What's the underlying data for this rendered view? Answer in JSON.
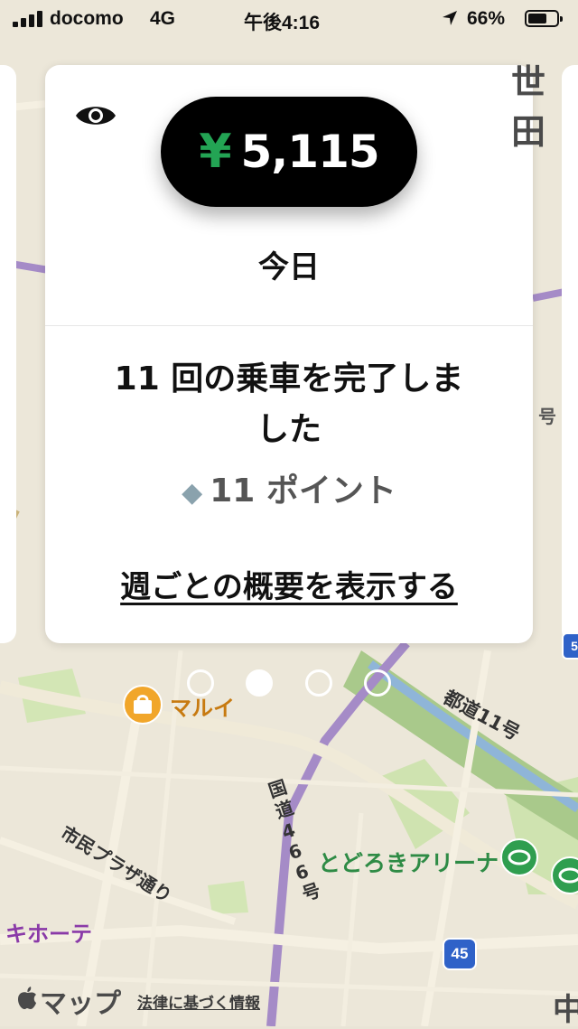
{
  "status_bar": {
    "carrier": "docomo",
    "network": "4G",
    "time": "午後4:16",
    "battery_percent_text": "66%",
    "battery_level": 0.66
  },
  "earnings_card": {
    "currency_symbol": "¥",
    "amount": "5,115",
    "period": "今日",
    "trips_line1": "11 回の乗車を完了しま",
    "trips_line2": "した",
    "points_icon": "◆",
    "points": "11 ポイント",
    "weekly_link": "週ごとの概要を表示する"
  },
  "pager": {
    "count": 4,
    "active_index": 1
  },
  "map": {
    "labels": {
      "marui": "マルイ",
      "route11": "都道11号",
      "route466": "国道466号",
      "plaza": "市民プラザ通り",
      "arena": "とどろきアリーナ",
      "donki": "キホーテ",
      "setagaya": "世田",
      "route_no": "号",
      "naka": "中",
      "shield45": "45",
      "shield5": "5"
    },
    "maps_logo": "マップ",
    "legal": "法律に基づく情報"
  },
  "icons": {
    "eye": "eye-icon",
    "location": "location-arrow-icon",
    "apple": "apple-icon",
    "shopping": "shopping-bag-icon",
    "stadium": "stadium-icon"
  },
  "colors": {
    "yen_green": "#23a454",
    "pill_bg": "#000000",
    "card_bg": "#ffffff",
    "points_diamond": "#8aa2ad"
  }
}
